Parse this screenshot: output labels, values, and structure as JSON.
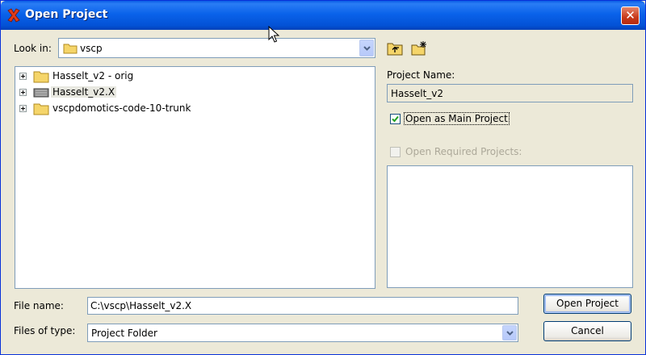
{
  "window": {
    "title": "Open Project",
    "close_glyph": "✕"
  },
  "look_in": {
    "label": "Look in:",
    "value": "vscp"
  },
  "tree": {
    "items": [
      {
        "label": "Hasselt_v2 - orig",
        "icon": "folder-icon"
      },
      {
        "label": "Hasselt_v2.X",
        "icon": "project-chip-icon",
        "selected": true
      },
      {
        "label": "vscpdomotics-code-10-trunk",
        "icon": "folder-icon"
      }
    ]
  },
  "project_panel": {
    "name_label": "Project Name:",
    "name_value": "Hasselt_v2",
    "open_main_label": "Open as Main Project",
    "open_main_checked": true,
    "open_required_label": "Open Required Projects:",
    "open_required_checked": false
  },
  "file_name": {
    "label": "File name:",
    "value": "C:\\vscp\\Hasselt_v2.X"
  },
  "files_of_type": {
    "label": "Files of type:",
    "value": "Project Folder"
  },
  "buttons": {
    "open": "Open Project",
    "cancel": "Cancel"
  },
  "colors": {
    "title_bar": "#0a5be5",
    "window_bg": "#ece9d8",
    "folder": "#f5d56a",
    "close_button": "#c8391a"
  }
}
